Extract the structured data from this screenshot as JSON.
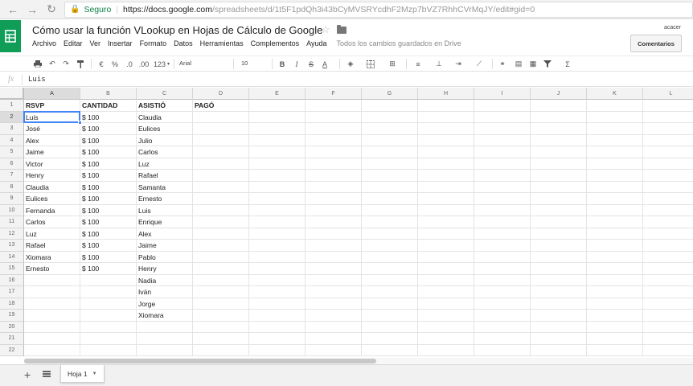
{
  "browser": {
    "secure_label": "Seguro",
    "url_host": "https://docs.google.com",
    "url_path": "/spreadsheets/d/1t5F1pdQh3i43bCyMVSRYcdhF2Mzp7bVZ7RhhCVrMqJY/edit#gid=0"
  },
  "doc": {
    "title": "Cómo usar la función VLookup en Hojas de Cálculo de Google",
    "account": "acacer",
    "comments_label": "Comentarios",
    "save_status": "Todos los cambios guardados en Drive"
  },
  "menu": [
    "Archivo",
    "Editar",
    "Ver",
    "Insertar",
    "Formato",
    "Datos",
    "Herramientas",
    "Complementos",
    "Ayuda"
  ],
  "toolbar": {
    "currency": "€",
    "percent": "%",
    "dec_decrease": ".0",
    "dec_increase": ".00",
    "more_formats": "123",
    "font": "Arial",
    "font_size": "10",
    "bold": "B",
    "italic": "I",
    "strike": "S",
    "text_color": "A",
    "sigma": "Σ"
  },
  "formula_bar": {
    "fx": "fx",
    "value": "Luis"
  },
  "grid": {
    "columns": [
      "A",
      "B",
      "C",
      "D",
      "E",
      "F",
      "G",
      "H",
      "I",
      "J",
      "K",
      "L"
    ],
    "row_count": 22,
    "rows": [
      [
        "RSVP",
        "CANTIDAD",
        "ASISTIÓ",
        "PAGÓ"
      ],
      [
        "Luis",
        "$ 100",
        "Claudia",
        ""
      ],
      [
        "José",
        "$ 100",
        "Eulices",
        ""
      ],
      [
        "Alex",
        "$ 100",
        "Julio",
        ""
      ],
      [
        "Jaime",
        "$ 100",
        "Carlos",
        ""
      ],
      [
        "Victor",
        "$ 100",
        "Luz",
        ""
      ],
      [
        "Henry",
        "$ 100",
        "Rafael",
        ""
      ],
      [
        "Claudia",
        "$ 100",
        "Samanta",
        ""
      ],
      [
        "Eulices",
        "$ 100",
        "Ernesto",
        ""
      ],
      [
        "Fernanda",
        "$ 100",
        "Luis",
        ""
      ],
      [
        "Carlos",
        "$ 100",
        "Enrique",
        ""
      ],
      [
        "Luz",
        "$ 100",
        "Alex",
        ""
      ],
      [
        "Rafael",
        "$ 100",
        "Jaime",
        ""
      ],
      [
        "Xiomara",
        "$ 100",
        "Pablo",
        ""
      ],
      [
        "Ernesto",
        "$ 100",
        "Henry",
        ""
      ],
      [
        "",
        "",
        "Nadia",
        ""
      ],
      [
        "",
        "",
        "Iván",
        ""
      ],
      [
        "",
        "",
        "Jorge",
        ""
      ],
      [
        "",
        "",
        "Xiomara",
        ""
      ],
      [
        "",
        "",
        "",
        ""
      ],
      [
        "",
        "",
        "",
        ""
      ],
      [
        "",
        "",
        "",
        ""
      ]
    ],
    "active_cell": "A2"
  },
  "sheets": {
    "tabs": [
      "Hoja 1"
    ]
  }
}
